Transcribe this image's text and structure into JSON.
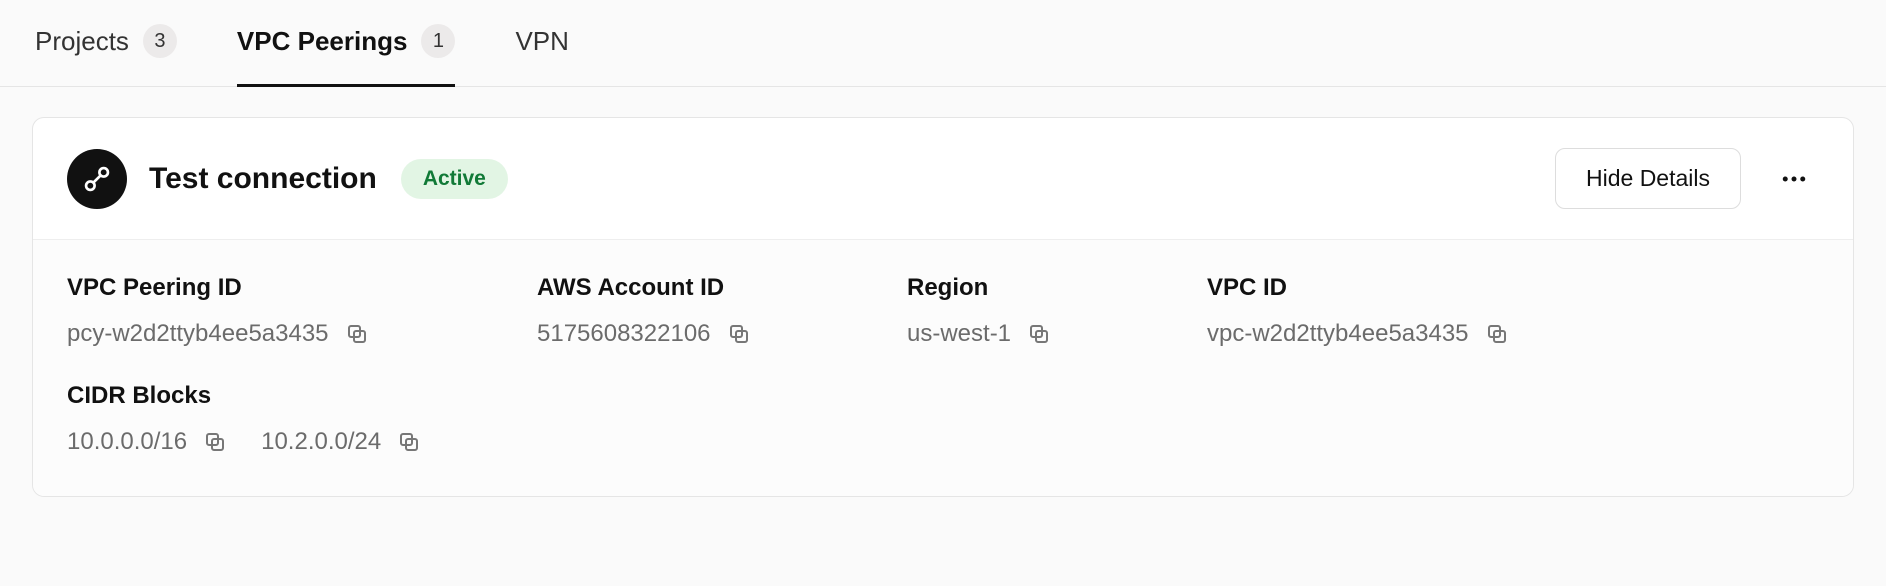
{
  "tabs": [
    {
      "label": "Projects",
      "count": "3",
      "active": false
    },
    {
      "label": "VPC Peerings",
      "count": "1",
      "active": true
    },
    {
      "label": "VPN",
      "count": null,
      "active": false
    }
  ],
  "connection": {
    "title": "Test connection",
    "status": "Active",
    "hide_label": "Hide Details"
  },
  "fields": {
    "peering_id": {
      "label": "VPC Peering ID",
      "value": "pcy-w2d2ttyb4ee5a3435"
    },
    "account_id": {
      "label": "AWS Account ID",
      "value": "5175608322106"
    },
    "region": {
      "label": "Region",
      "value": "us-west-1"
    },
    "vpc_id": {
      "label": "VPC ID",
      "value": "vpc-w2d2ttyb4ee5a3435"
    },
    "cidr": {
      "label": "CIDR Blocks",
      "values": [
        "10.0.0.0/16",
        "10.2.0.0/24"
      ]
    }
  }
}
